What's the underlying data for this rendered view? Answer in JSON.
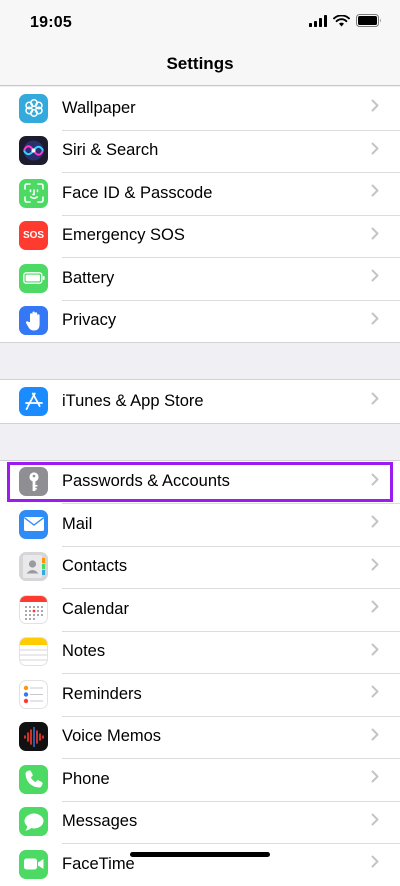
{
  "status": {
    "time": "19:05"
  },
  "nav": {
    "title": "Settings"
  },
  "groups": [
    {
      "items": [
        {
          "label": "Wallpaper",
          "icon": "wallpaper-icon",
          "color": "#34aadc"
        },
        {
          "label": "Siri & Search",
          "icon": "siri-icon",
          "color": "#1c1c2e"
        },
        {
          "label": "Face ID & Passcode",
          "icon": "face-id-icon",
          "color": "#4cd964"
        },
        {
          "label": "Emergency SOS",
          "icon": "sos-icon",
          "color": "#ff3b30",
          "icon_text": "SOS"
        },
        {
          "label": "Battery",
          "icon": "battery-icon",
          "color": "#4cd964"
        },
        {
          "label": "Privacy",
          "icon": "hand-icon",
          "color": "#3478f6"
        }
      ]
    },
    {
      "items": [
        {
          "label": "iTunes & App Store",
          "icon": "app-store-icon",
          "color": "#1a8cff"
        }
      ]
    },
    {
      "items": [
        {
          "label": "Passwords & Accounts",
          "icon": "key-icon",
          "color": "#8e8e93",
          "highlighted": true
        },
        {
          "label": "Mail",
          "icon": "mail-icon",
          "color": "#2f8cf6"
        },
        {
          "label": "Contacts",
          "icon": "contacts-icon",
          "color": "#c9c9cc"
        },
        {
          "label": "Calendar",
          "icon": "calendar-icon",
          "color": "#ffffff"
        },
        {
          "label": "Notes",
          "icon": "notes-icon",
          "color": "#ffffff"
        },
        {
          "label": "Reminders",
          "icon": "reminders-icon",
          "color": "#ffffff"
        },
        {
          "label": "Voice Memos",
          "icon": "voice-memos-icon",
          "color": "#111111"
        },
        {
          "label": "Phone",
          "icon": "phone-icon",
          "color": "#4cd964"
        },
        {
          "label": "Messages",
          "icon": "messages-icon",
          "color": "#4cd964"
        },
        {
          "label": "FaceTime",
          "icon": "facetime-icon",
          "color": "#4cd964"
        }
      ]
    }
  ]
}
